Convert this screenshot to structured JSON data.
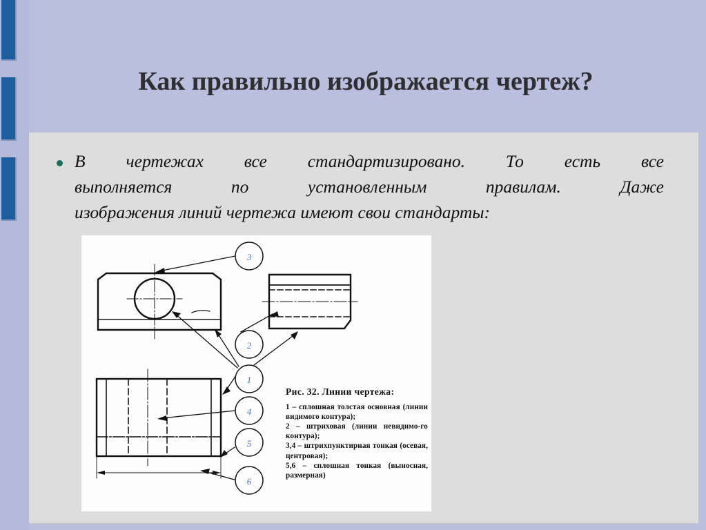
{
  "slide": {
    "title": "Как правильно изображается чертеж?",
    "background_color": "#b9bfdd",
    "panel_color": "#dddddd",
    "accent_color": "#1d5f9e",
    "bullet_color": "#1f6b5c"
  },
  "body": {
    "bullet_text_line1": "В чертежах все стандартизировано. То есть все",
    "bullet_text_line2": "выполняется по установленным правилам. Даже",
    "bullet_text_line3": "изображения линий чертежа имеют свои стандарты:",
    "bullet_text_full": "В чертежах все стандартизировано. То есть все выполняется по установленным правилам. Даже изображения линий чертежа имеют свои стандарты:"
  },
  "figure": {
    "caption_title": "Рис. 32. Линии чертежа:",
    "legend": [
      "1 – сплошная толстая основная (линии видимого контура);",
      "2 – штриховая (линии невидимо-го контура);",
      "3,4 – штрихпунктирная тонкая (осевая, центровая);",
      "5,6 – сплошная тонкая (выносная, размерная)"
    ],
    "callout_numbers": [
      "1",
      "2",
      "3",
      "4",
      "5",
      "6"
    ],
    "callout_color": "#4a6fb0"
  }
}
